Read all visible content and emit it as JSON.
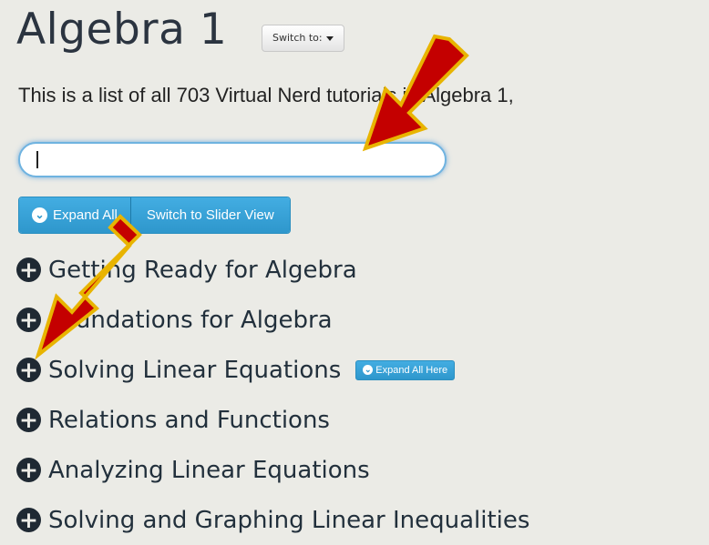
{
  "header": {
    "title": "Algebra 1",
    "switch_label": "Switch to:"
  },
  "intro": {
    "text": "This is a list of all 703 Virtual Nerd tutorials in Algebra 1,"
  },
  "search": {
    "value": ""
  },
  "toolbar": {
    "expand_all_label": "Expand All",
    "slider_view_label": "Switch to Slider View"
  },
  "units": [
    {
      "title": "Getting Ready for Algebra"
    },
    {
      "title": "Foundations for Algebra"
    },
    {
      "title": "Solving Linear Equations",
      "expand_here_label": "Expand All Here"
    },
    {
      "title": "Relations and Functions"
    },
    {
      "title": "Analyzing Linear Equations"
    },
    {
      "title": "Solving and Graphing Linear Inequalities"
    }
  ],
  "colors": {
    "accent": "#2e97cc",
    "arrow": "#cc0000",
    "arrow_outline": "#e8b400",
    "background": "#ebebe6"
  },
  "icons": {
    "unit_toggle": "plus-circle-icon",
    "expand": "chevron-down-circle-icon",
    "dropdown": "caret-down-icon"
  }
}
